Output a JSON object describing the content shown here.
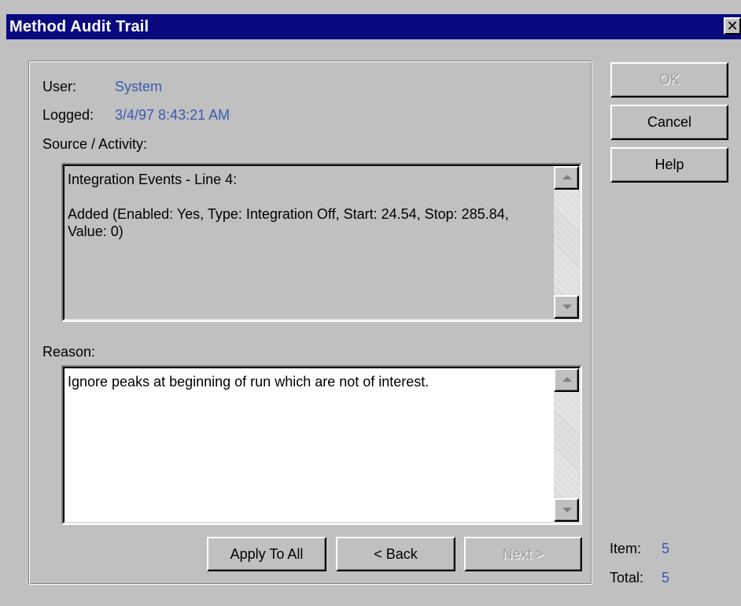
{
  "window": {
    "title": "Method Audit Trail",
    "close_glyph": "✕"
  },
  "fields": {
    "user_label": "User:",
    "user_value": "System",
    "logged_label": "Logged:",
    "logged_value": "3/4/97 8:43:21 AM",
    "source_label": "Source / Activity:",
    "source_text": "Integration Events - Line 4:\n\nAdded (Enabled: Yes, Type: Integration Off, Start: 24.54, Stop: 285.84, Value: 0)",
    "reason_label": "Reason:",
    "reason_text": "Ignore peaks at beginning of run which are not of interest."
  },
  "buttons": {
    "ok": "OK",
    "cancel": "Cancel",
    "help": "Help",
    "apply_to_all": "Apply To All",
    "back": "< Back",
    "next": "Next >"
  },
  "counter": {
    "item_label": "Item:",
    "item_value": "5",
    "total_label": "Total:",
    "total_value": "5"
  },
  "colors": {
    "titlebar": "#0a0a80",
    "dialog_bg": "#c0c0c0",
    "value_text": "#3a5ab0"
  }
}
